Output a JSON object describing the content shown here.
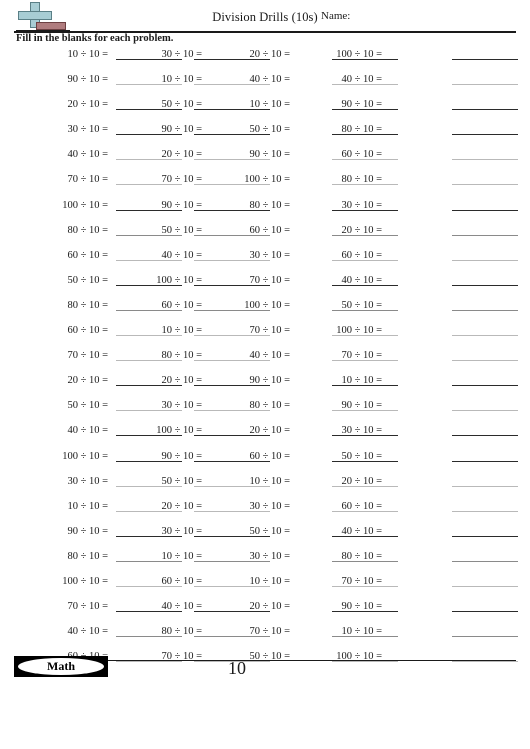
{
  "header": {
    "title": "Division Drills (10s)",
    "name_label": "Name:",
    "logo": {
      "plus_color": "#a8cdd4",
      "minus_color": "#b07c7e",
      "outline_color": "#5a7f86"
    }
  },
  "instructions": "Fill in the blanks for each problem.",
  "footer": {
    "brand": "Math",
    "page_number": "10"
  },
  "worksheet": {
    "divisor": "10",
    "operator": "÷",
    "equals": "=",
    "columns": 5,
    "rows": 25,
    "blank_columns": [
      5
    ],
    "rows_data": [
      {
        "c1": "10 ÷ 10 =",
        "c2": "30 ÷ 10 =",
        "c3": "20 ÷ 10 =",
        "c4": "100 ÷ 10 ="
      },
      {
        "c1": "90 ÷ 10 =",
        "c2": "10 ÷ 10 =",
        "c3": "40 ÷ 10 =",
        "c4": "40 ÷ 10 ="
      },
      {
        "c1": "20 ÷ 10 =",
        "c2": "50 ÷ 10 =",
        "c3": "10 ÷ 10 =",
        "c4": "90 ÷ 10 ="
      },
      {
        "c1": "30 ÷ 10 =",
        "c2": "90 ÷ 10 =",
        "c3": "50 ÷ 10 =",
        "c4": "80 ÷ 10 ="
      },
      {
        "c1": "40 ÷ 10 =",
        "c2": "20 ÷ 10 =",
        "c3": "90 ÷ 10 =",
        "c4": "60 ÷ 10 ="
      },
      {
        "c1": "70 ÷ 10 =",
        "c2": "70 ÷ 10 =",
        "c3": "100 ÷ 10 =",
        "c4": "80 ÷ 10 ="
      },
      {
        "c1": "100 ÷ 10 =",
        "c2": "90 ÷ 10 =",
        "c3": "80 ÷ 10 =",
        "c4": "30 ÷ 10 ="
      },
      {
        "c1": "80 ÷ 10 =",
        "c2": "50 ÷ 10 =",
        "c3": "60 ÷ 10 =",
        "c4": "20 ÷ 10 ="
      },
      {
        "c1": "60 ÷ 10 =",
        "c2": "40 ÷ 10 =",
        "c3": "30 ÷ 10 =",
        "c4": "60 ÷ 10 ="
      },
      {
        "c1": "50 ÷ 10 =",
        "c2": "100 ÷ 10 =",
        "c3": "70 ÷ 10 =",
        "c4": "40 ÷ 10 ="
      },
      {
        "c1": "80 ÷ 10 =",
        "c2": "60 ÷ 10 =",
        "c3": "100 ÷ 10 =",
        "c4": "50 ÷ 10 ="
      },
      {
        "c1": "60 ÷ 10 =",
        "c2": "10 ÷ 10 =",
        "c3": "70 ÷ 10 =",
        "c4": "100 ÷ 10 ="
      },
      {
        "c1": "70 ÷ 10 =",
        "c2": "80 ÷ 10 =",
        "c3": "40 ÷ 10 =",
        "c4": "70 ÷ 10 ="
      },
      {
        "c1": "20 ÷ 10 =",
        "c2": "20 ÷ 10 =",
        "c3": "90 ÷ 10 =",
        "c4": "10 ÷ 10 ="
      },
      {
        "c1": "50 ÷ 10 =",
        "c2": "30 ÷ 10 =",
        "c3": "80 ÷ 10 =",
        "c4": "90 ÷ 10 ="
      },
      {
        "c1": "40 ÷ 10 =",
        "c2": "100 ÷ 10 =",
        "c3": "20 ÷ 10 =",
        "c4": "30 ÷ 10 ="
      },
      {
        "c1": "100 ÷ 10 =",
        "c2": "90 ÷ 10 =",
        "c3": "60 ÷ 10 =",
        "c4": "50 ÷ 10 ="
      },
      {
        "c1": "30 ÷ 10 =",
        "c2": "50 ÷ 10 =",
        "c3": "10 ÷ 10 =",
        "c4": "20 ÷ 10 ="
      },
      {
        "c1": "10 ÷ 10 =",
        "c2": "20 ÷ 10 =",
        "c3": "30 ÷ 10 =",
        "c4": "60 ÷ 10 ="
      },
      {
        "c1": "90 ÷ 10 =",
        "c2": "30 ÷ 10 =",
        "c3": "50 ÷ 10 =",
        "c4": "40 ÷ 10 ="
      },
      {
        "c1": "80 ÷ 10 =",
        "c2": "10 ÷ 10 =",
        "c3": "30 ÷ 10 =",
        "c4": "80 ÷ 10 ="
      },
      {
        "c1": "100 ÷ 10 =",
        "c2": "60 ÷ 10 =",
        "c3": "10 ÷ 10 =",
        "c4": "70 ÷ 10 ="
      },
      {
        "c1": "70 ÷ 10 =",
        "c2": "40 ÷ 10 =",
        "c3": "20 ÷ 10 =",
        "c4": "90 ÷ 10 ="
      },
      {
        "c1": "40 ÷ 10 =",
        "c2": "80 ÷ 10 =",
        "c3": "70 ÷ 10 =",
        "c4": "10 ÷ 10 ="
      },
      {
        "c1": "60 ÷ 10 =",
        "c2": "70 ÷ 10 =",
        "c3": "50 ÷ 10 =",
        "c4": "100 ÷ 10 ="
      }
    ]
  }
}
